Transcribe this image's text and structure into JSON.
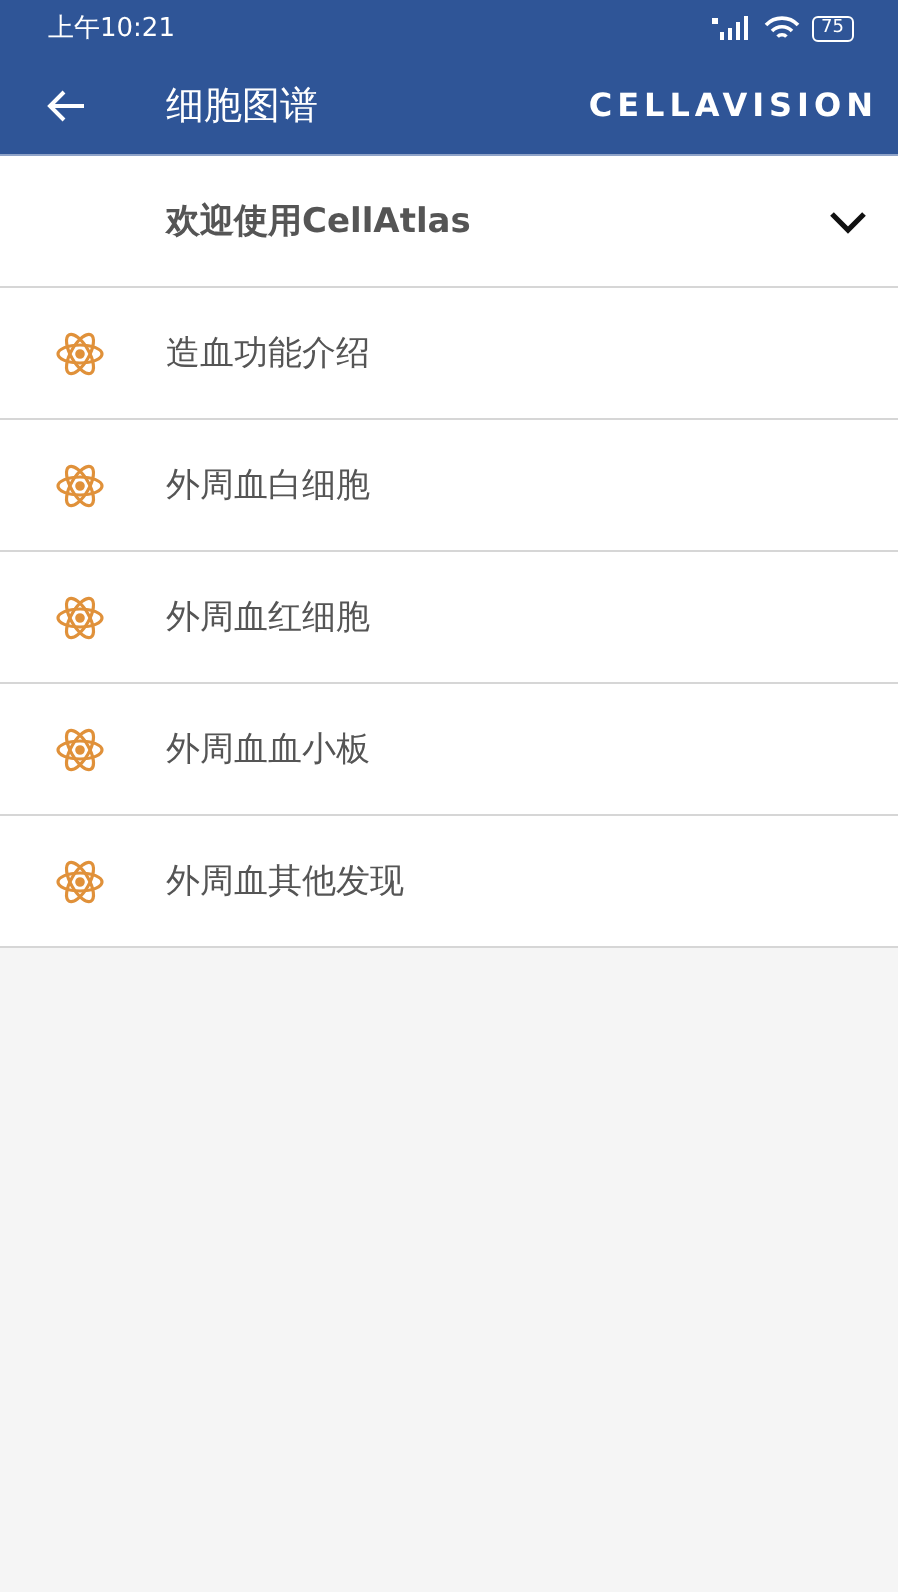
{
  "status_bar": {
    "time": "上午10:21",
    "battery": "75"
  },
  "header": {
    "title": "细胞图谱",
    "logo": "CELLAVISION"
  },
  "welcome": {
    "label": "欢迎使用CellAtlas",
    "expanded": false
  },
  "items": [
    {
      "label": "造血功能介绍"
    },
    {
      "label": "外周血白细胞"
    },
    {
      "label": "外周血红细胞"
    },
    {
      "label": "外周血血小板"
    },
    {
      "label": "外周血其他发现"
    }
  ]
}
